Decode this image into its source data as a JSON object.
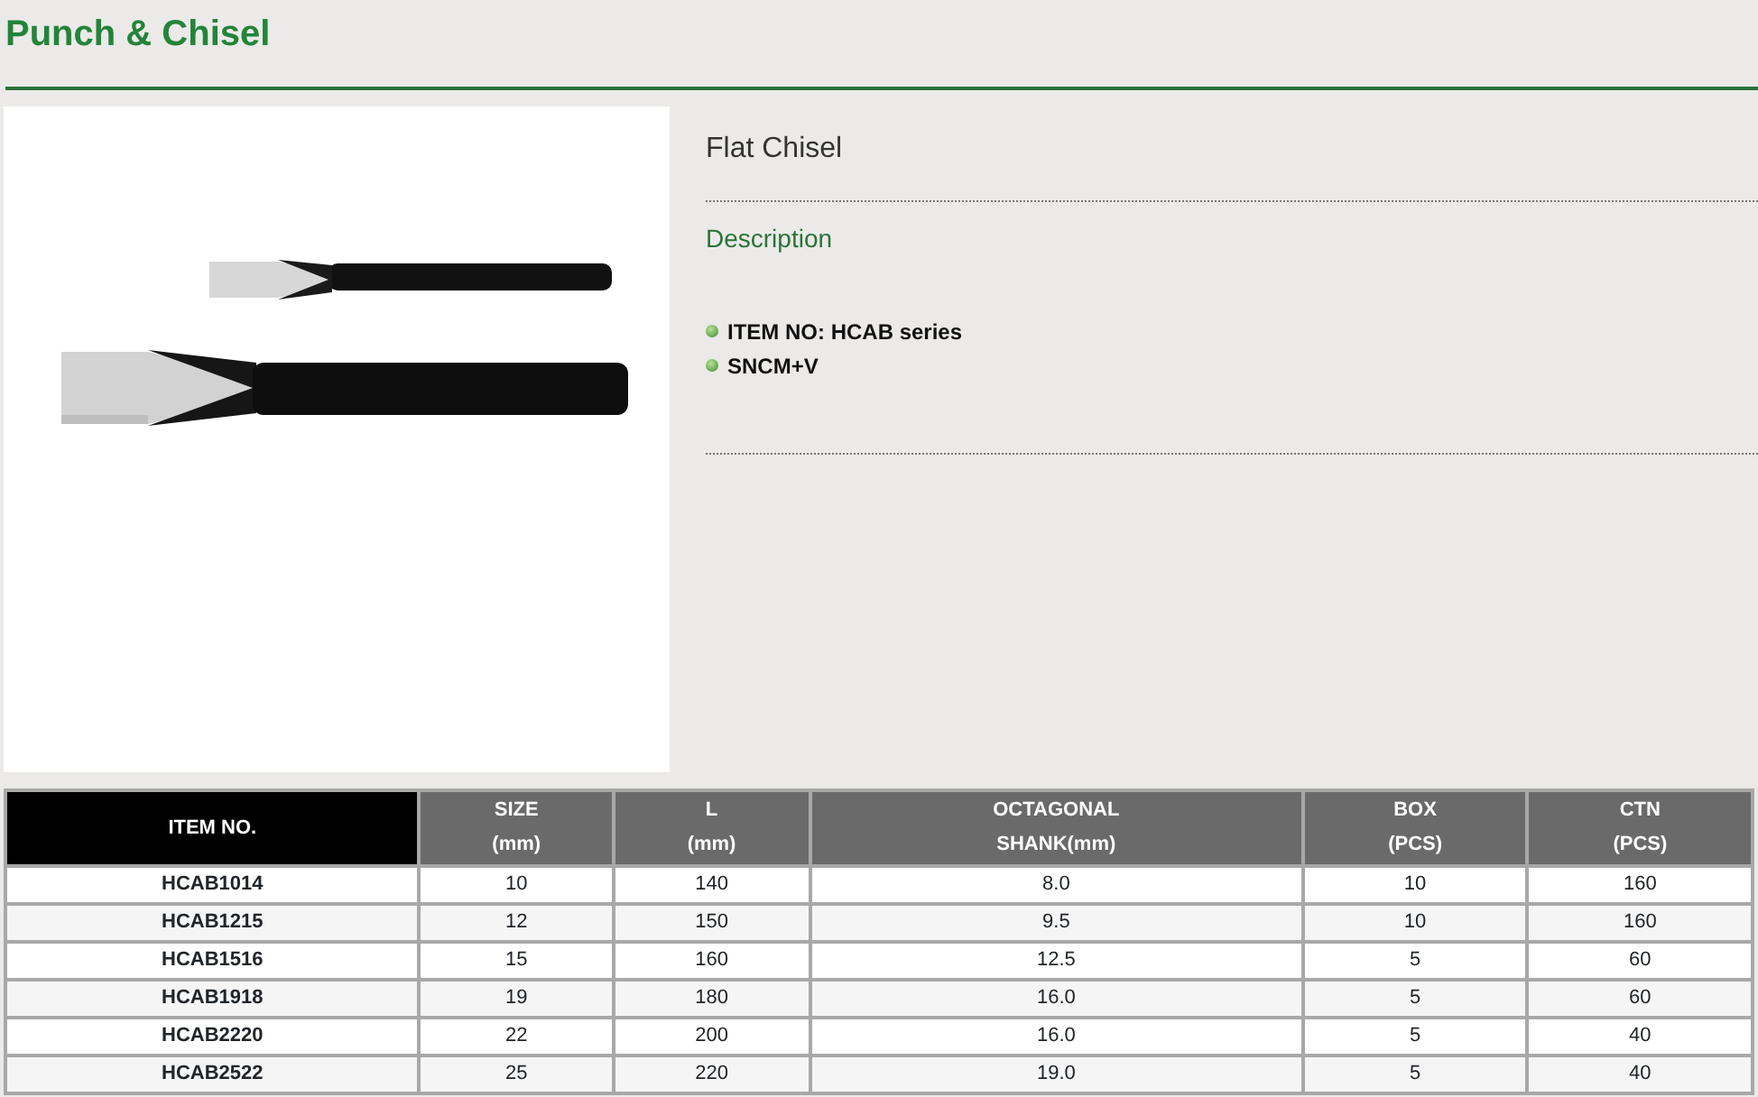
{
  "page_title": "Punch & Chisel",
  "product": {
    "name": "Flat Chisel",
    "section_label": "Description",
    "features": [
      "ITEM NO: HCAB series",
      "SNCM+V"
    ]
  },
  "table": {
    "columns": [
      {
        "lines": [
          "ITEM NO."
        ]
      },
      {
        "lines": [
          "SIZE",
          "(mm)"
        ]
      },
      {
        "lines": [
          "L",
          "(mm)"
        ]
      },
      {
        "lines": [
          "OCTAGONAL",
          "SHANK(mm)"
        ]
      },
      {
        "lines": [
          "BOX",
          "(PCS)"
        ]
      },
      {
        "lines": [
          "CTN",
          "(PCS)"
        ]
      }
    ],
    "rows": [
      [
        "HCAB1014",
        "10",
        "140",
        "8.0",
        "10",
        "160"
      ],
      [
        "HCAB1215",
        "12",
        "150",
        "9.5",
        "10",
        "160"
      ],
      [
        "HCAB1516",
        "15",
        "160",
        "12.5",
        "5",
        "60"
      ],
      [
        "HCAB1918",
        "19",
        "180",
        "16.0",
        "5",
        "60"
      ],
      [
        "HCAB2220",
        "22",
        "200",
        "16.0",
        "5",
        "40"
      ],
      [
        "HCAB2522",
        "25",
        "220",
        "19.0",
        "5",
        "40"
      ]
    ]
  }
}
